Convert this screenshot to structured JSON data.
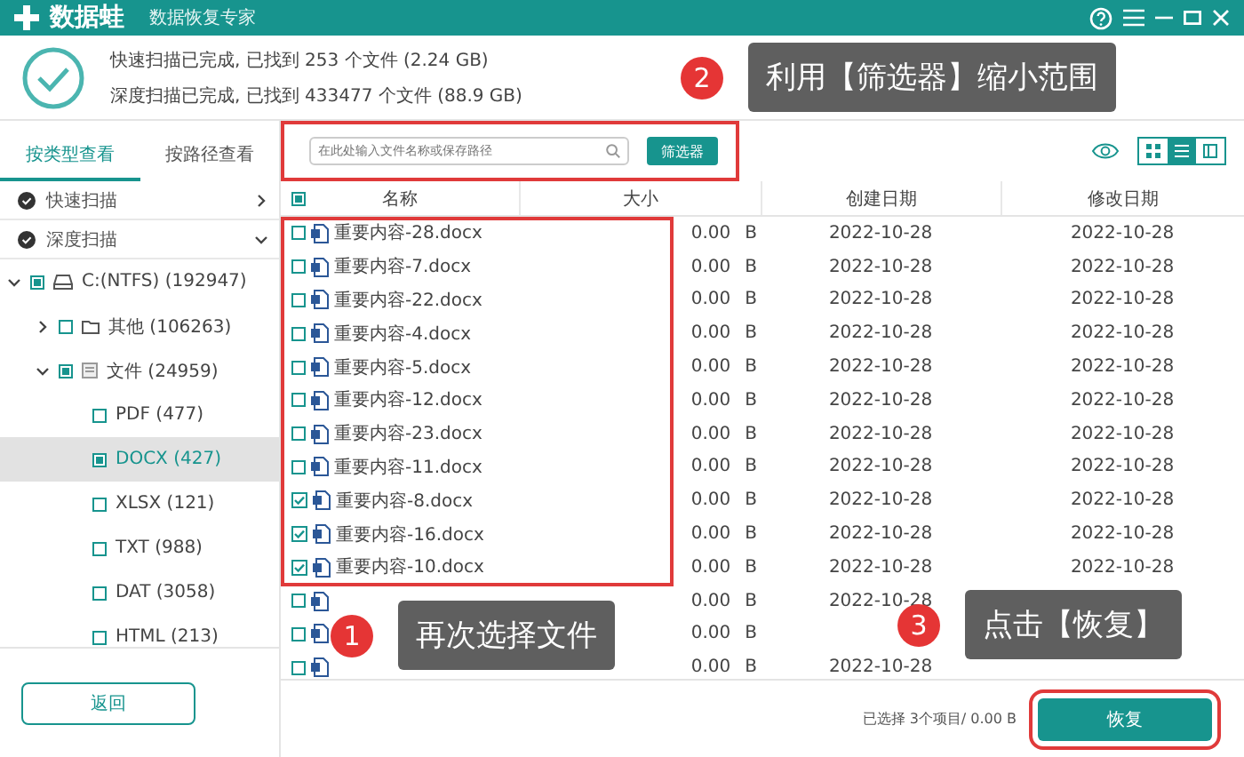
{
  "app": {
    "name": "数据蛙",
    "subtitle": "数据恢复专家"
  },
  "scan": {
    "lines": [
      "快速扫描已完成, 已找到 253 个文件 (2.24 GB)",
      "深度扫描已完成, 已找到 433477 个文件 (88.9 GB)"
    ]
  },
  "view_tabs": [
    {
      "label": "按类型查看",
      "selected": true
    },
    {
      "label": "按路径查看",
      "selected": false
    }
  ],
  "search": {
    "placeholder": "在此处输入文件名称或保存路径"
  },
  "filter_button": "筛选器",
  "view_modes": [
    {
      "kind": "grid",
      "selected": false
    },
    {
      "kind": "list",
      "selected": true
    },
    {
      "kind": "panel",
      "selected": false
    }
  ],
  "scan_modes": [
    {
      "label": "快速扫描",
      "expanded": false
    },
    {
      "label": "深度扫描",
      "expanded": true
    }
  ],
  "tree": [
    {
      "label": "C:(NTFS) (192947)",
      "kind": "drive",
      "indeterminate": true,
      "expanded": true,
      "selected": false,
      "children": [
        {
          "label": "其他 (106263)",
          "kind": "folder",
          "indeterminate": false,
          "expanded": false,
          "selected": false
        },
        {
          "label": "文件 (24959)",
          "kind": "docs",
          "indeterminate": true,
          "expanded": true,
          "selected": false,
          "children": [
            {
              "label": "PDF (477)",
              "kind": "type",
              "indeterminate": false,
              "selected": false
            },
            {
              "label": "DOCX (427)",
              "kind": "type",
              "indeterminate": true,
              "selected": true
            },
            {
              "label": "XLSX (121)",
              "kind": "type",
              "indeterminate": false,
              "selected": false
            },
            {
              "label": "TXT (988)",
              "kind": "type",
              "indeterminate": false,
              "selected": false
            },
            {
              "label": "DAT (3058)",
              "kind": "type",
              "indeterminate": false,
              "selected": false
            },
            {
              "label": "HTML (213)",
              "kind": "type",
              "indeterminate": false,
              "selected": false
            }
          ]
        }
      ]
    }
  ],
  "table": {
    "all_indeterminate": true,
    "columns": [
      "名称",
      "大小",
      "创建日期",
      "修改日期"
    ],
    "rows": [
      {
        "checked": false,
        "name": "重要内容-28.docx",
        "size": "0.00",
        "unit": "B",
        "created": "2022-10-28",
        "modified": "2022-10-28"
      },
      {
        "checked": false,
        "name": "重要内容-7.docx",
        "size": "0.00",
        "unit": "B",
        "created": "2022-10-28",
        "modified": "2022-10-28"
      },
      {
        "checked": false,
        "name": "重要内容-22.docx",
        "size": "0.00",
        "unit": "B",
        "created": "2022-10-28",
        "modified": "2022-10-28"
      },
      {
        "checked": false,
        "name": "重要内容-4.docx",
        "size": "0.00",
        "unit": "B",
        "created": "2022-10-28",
        "modified": "2022-10-28"
      },
      {
        "checked": false,
        "name": "重要内容-5.docx",
        "size": "0.00",
        "unit": "B",
        "created": "2022-10-28",
        "modified": "2022-10-28"
      },
      {
        "checked": false,
        "name": "重要内容-12.docx",
        "size": "0.00",
        "unit": "B",
        "created": "2022-10-28",
        "modified": "2022-10-28"
      },
      {
        "checked": false,
        "name": "重要内容-23.docx",
        "size": "0.00",
        "unit": "B",
        "created": "2022-10-28",
        "modified": "2022-10-28"
      },
      {
        "checked": false,
        "name": "重要内容-11.docx",
        "size": "0.00",
        "unit": "B",
        "created": "2022-10-28",
        "modified": "2022-10-28"
      },
      {
        "checked": true,
        "name": "重要内容-8.docx",
        "size": "0.00",
        "unit": "B",
        "created": "2022-10-28",
        "modified": "2022-10-28"
      },
      {
        "checked": true,
        "name": "重要内容-16.docx",
        "size": "0.00",
        "unit": "B",
        "created": "2022-10-28",
        "modified": "2022-10-28"
      },
      {
        "checked": true,
        "name": "重要内容-10.docx",
        "size": "0.00",
        "unit": "B",
        "created": "2022-10-28",
        "modified": "2022-10-28"
      },
      {
        "checked": false,
        "size": "0.00",
        "unit": "B",
        "created": "2022-10-28"
      },
      {
        "checked": false,
        "size": "0.00",
        "unit": "B"
      },
      {
        "checked": false,
        "size": "0.00",
        "unit": "B",
        "created": "2022-10-28"
      }
    ]
  },
  "back_button": "返回",
  "selection_summary": "已选择 3个项目/ 0.00 B",
  "recover_button": "恢复",
  "callouts": [
    {
      "number": "2",
      "text": "利用【筛选器】缩小范围"
    },
    {
      "number": "1",
      "text": "再次选择文件"
    },
    {
      "number": "3",
      "text": "点击【恢复】"
    }
  ]
}
